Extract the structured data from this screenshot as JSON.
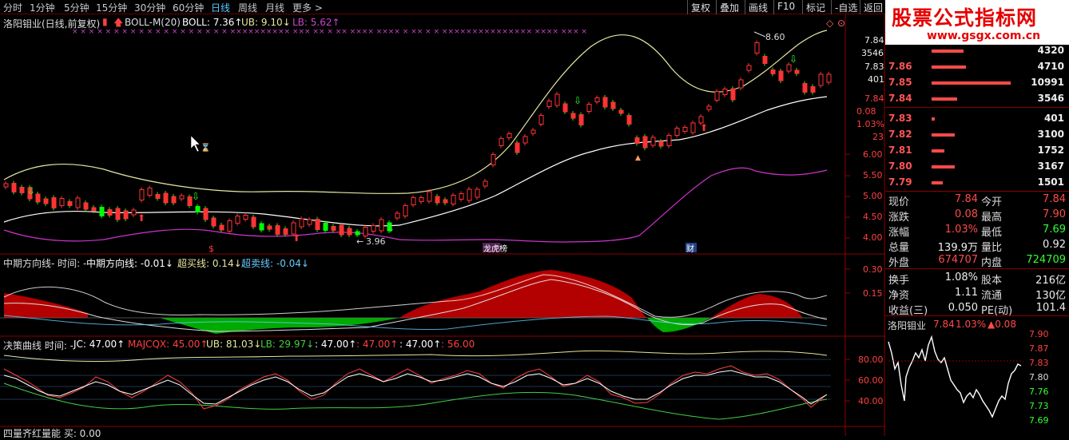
{
  "toolbar": {
    "timeframes": [
      "分时",
      "1分钟",
      "5分钟",
      "15分钟",
      "30分钟",
      "60分钟",
      "日线",
      "周线",
      "月线",
      "更多 >"
    ],
    "active_timeframe": "日线",
    "right_buttons": [
      "复权",
      "叠加",
      "画线",
      "F10",
      "标记",
      "-自选",
      "返回"
    ]
  },
  "logo": {
    "text": "股票公式指标网",
    "url": "www.gsgx.com.cn"
  },
  "main_header": {
    "title": "洛阳钼业(日线,前复权)",
    "indicator": "BOLL-M(20)",
    "boll": "BOLL: 7.36↑",
    "ub": "UB: 9.10↓",
    "lb": "LB: 5.62↑"
  },
  "price_axis": [
    "7.84",
    "3546",
    "7.83",
    "401",
    "7.84",
    "0.08",
    "1.03%",
    "23",
    "6.00",
    "5.50",
    "5.00",
    "4.50",
    "4.00"
  ],
  "chart_annotations": {
    "high": "8.60",
    "low": "3.96",
    "mark1": "$",
    "mark2": "龙虎榜",
    "mark3": "财"
  },
  "mid_header": {
    "title": "中期方向线- 时间: -",
    "line1": "中期方向线: -0.01↓",
    "line2": "超买线: 0.14↓",
    "line3": "超卖线: -0.04↓"
  },
  "mid_axis": [
    "0.30",
    "0.15"
  ],
  "lower_header": {
    "title": "决策曲线 时间: -",
    "jc": "JC: 47.00↑",
    "majcqx": "MAJCQX: 45.00↑",
    "ub": "UB: 81.03↓",
    "lb": "LB: 29.97↓",
    "v1": ": 47.00↑",
    "v2": ": 47.00↑",
    "v3": ": 47.00↑",
    "v4": ": 56.00"
  },
  "lower_axis": [
    "80.00",
    "60.00",
    "40.00"
  ],
  "footer": {
    "text": "四量齐红量能 买: 0.00"
  },
  "orderbook": [
    {
      "label": "",
      "price": "",
      "vol": "4320",
      "bar": 0.25
    },
    {
      "label": "7.86",
      "price": "",
      "vol": "4710",
      "bar": 0.27
    },
    {
      "label": "7.85",
      "price": "",
      "vol": "10991",
      "bar": 0.62
    },
    {
      "label": "7.84",
      "price": "",
      "vol": "3546",
      "bar": 0.2
    },
    {
      "label": "7.83",
      "price": "",
      "vol": "401",
      "bar": 0.02
    },
    {
      "label": "7.82",
      "price": "",
      "vol": "3100",
      "bar": 0.18
    },
    {
      "label": "7.81",
      "price": "",
      "vol": "1752",
      "bar": 0.1
    },
    {
      "label": "7.80",
      "price": "",
      "vol": "3167",
      "bar": 0.18
    },
    {
      "label": "7.79",
      "price": "",
      "vol": "1501",
      "bar": 0.09
    }
  ],
  "stats": [
    {
      "k1": "现价",
      "v1": "7.84",
      "c1": "#ff4a4a",
      "k2": "今开",
      "v2": "7.84",
      "c2": "#ff4a4a"
    },
    {
      "k1": "涨跌",
      "v1": "0.08",
      "c1": "#ff4a4a",
      "k2": "最高",
      "v2": "7.90",
      "c2": "#ff4a4a"
    },
    {
      "k1": "涨幅",
      "v1": "1.03%",
      "c1": "#ff4a4a",
      "k2": "最低",
      "v2": "7.69",
      "c2": "#33ff33"
    },
    {
      "k1": "总量",
      "v1": "139.9万",
      "c1": "#eee",
      "k2": "量比",
      "v2": "0.92",
      "c2": "#eee"
    },
    {
      "k1": "外盘",
      "v1": "674707",
      "c1": "#ff4a4a",
      "k2": "内盘",
      "v2": "724709",
      "c2": "#33ff33"
    },
    {
      "k1": "换手",
      "v1": "1.08%",
      "c1": "#eee",
      "k2": "股本",
      "v2": "216亿",
      "c2": "#eee"
    },
    {
      "k1": "净资",
      "v1": "1.11",
      "c1": "#eee",
      "k2": "流通",
      "v2": "130亿",
      "c2": "#eee"
    },
    {
      "k1": "收益(三)",
      "v1": "0.050",
      "c1": "#eee",
      "k2": "PE(动)",
      "v2": "101.4",
      "c2": "#eee"
    }
  ],
  "mini": {
    "name": "洛阳钼业",
    "price": "7.84",
    "pct": "1.03%",
    "chg": "▲0.08",
    "axis": [
      "7.90",
      "7.87",
      "7.83",
      "7.80",
      "7.76",
      "7.73",
      "7.69"
    ]
  },
  "colors": {
    "up": "#ff3333",
    "down": "#00ff00",
    "boll": "#ffffff",
    "ub": "#e6e6a0",
    "lb": "#cc33cc",
    "grid": "#8b0000"
  }
}
